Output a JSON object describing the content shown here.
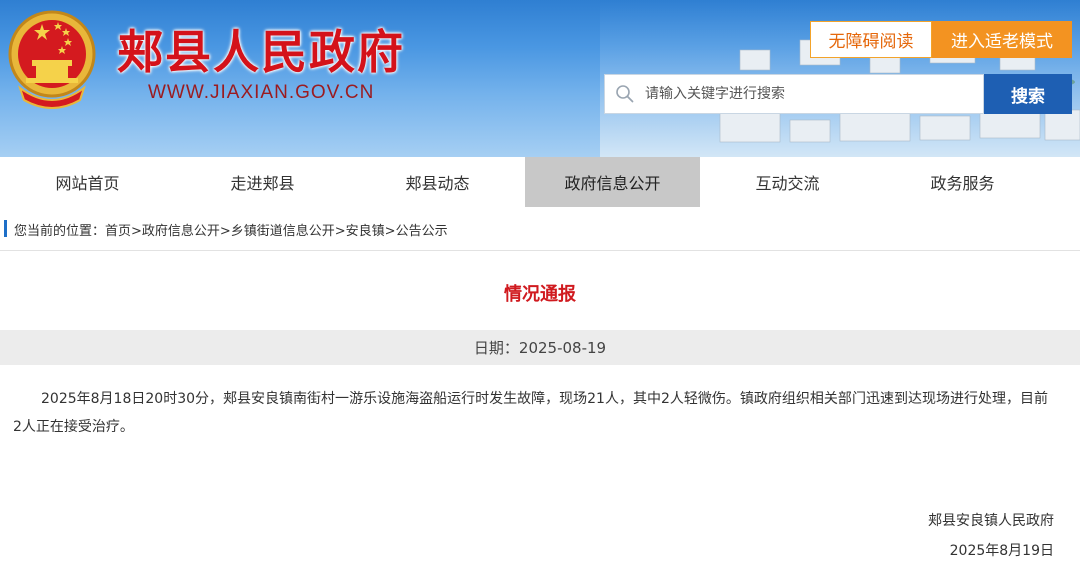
{
  "header": {
    "site_title": "郏县人民政府",
    "site_url": "WWW.JIAXIAN.GOV.CN",
    "accessibility_button": "无障碍阅读",
    "elder_mode_button": "进入适老模式",
    "search": {
      "placeholder": "请输入关键字进行搜索",
      "button_label": "搜索"
    }
  },
  "nav": {
    "items": [
      {
        "label": "网站首页",
        "active": false
      },
      {
        "label": "走进郏县",
        "active": false
      },
      {
        "label": "郏县动态",
        "active": false
      },
      {
        "label": "政府信息公开",
        "active": true
      },
      {
        "label": "互动交流",
        "active": false
      },
      {
        "label": "政务服务",
        "active": false
      }
    ]
  },
  "breadcrumb": {
    "text": "您当前的位置：首页>政府信息公开>乡镇街道信息公开>安良镇>公告公示"
  },
  "article": {
    "title": "情况通报",
    "date_text": "日期：2025-08-19",
    "body": "2025年8月18日20时30分，郏县安良镇南街村一游乐设施海盗船运行时发生故障，现场21人，其中2人轻微伤。镇政府组织相关部门迅速到达现场进行处理，目前2人正在接受治疗。",
    "signature_org": "郏县安良镇人民政府",
    "signature_date": "2025年8月19日"
  },
  "colors": {
    "title_red": "#d4121a",
    "accent_orange": "#f39321",
    "search_blue": "#1e5fb3",
    "active_nav_gray": "#c8c8c8"
  }
}
